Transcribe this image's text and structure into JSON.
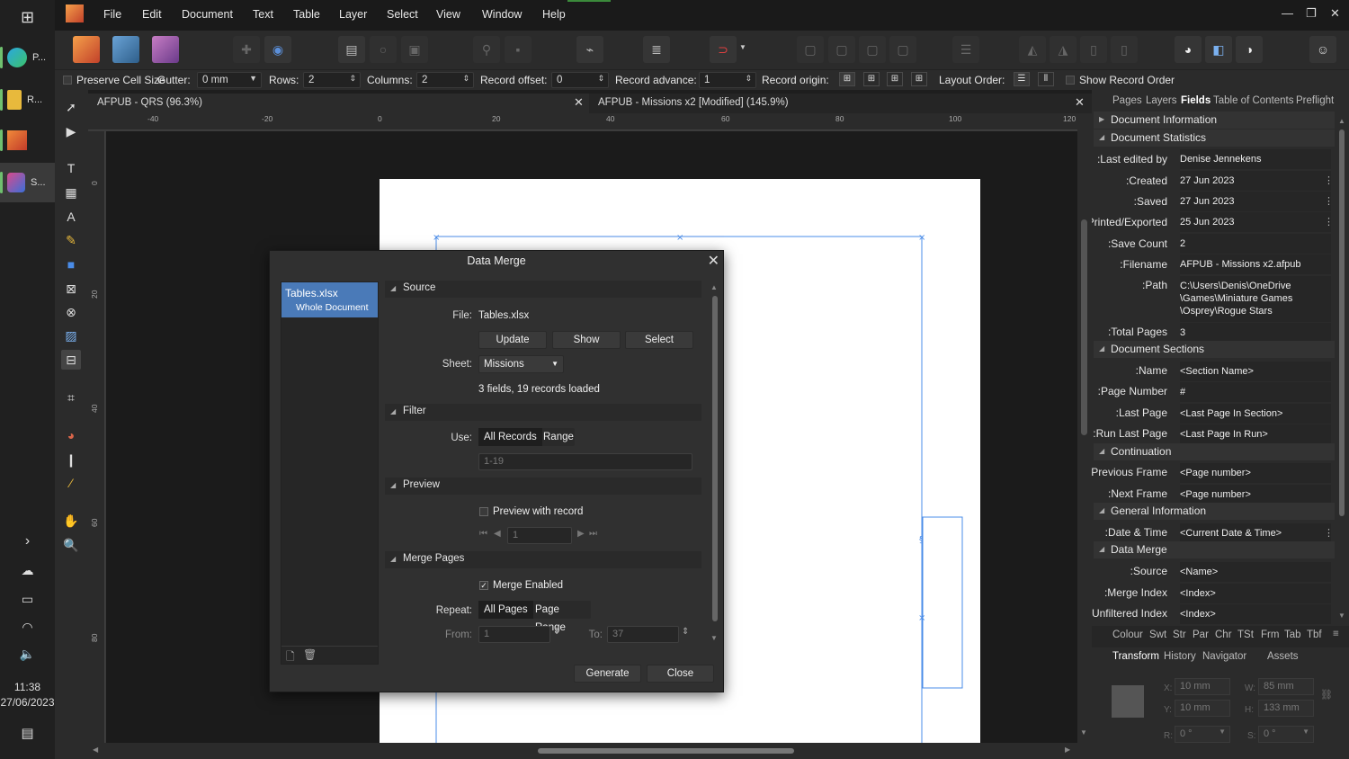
{
  "menubar": {
    "items": [
      "File",
      "Edit",
      "Document",
      "Text",
      "Table",
      "Layer",
      "Select",
      "View",
      "Window",
      "Help"
    ]
  },
  "taskbar": {
    "apps": [
      "P...",
      "R...",
      "",
      "S..."
    ],
    "time": "11:38",
    "date": "27/06/2023"
  },
  "contextbar": {
    "preserve_cell_size": "Preserve Cell Size",
    "gutter_label": "Gutter:",
    "gutter_value": "0 mm",
    "rows_label": "Rows:",
    "rows_value": "2",
    "columns_label": "Columns:",
    "columns_value": "2",
    "record_offset_label": "Record offset:",
    "record_offset_value": "0",
    "record_advance_label": "Record advance:",
    "record_advance_value": "1",
    "record_origin_label": "Record origin:",
    "layout_order_label": "Layout Order:",
    "show_record_order": "Show Record Order"
  },
  "doctabs": [
    {
      "label": "AFPUB - QRS (96.3%)"
    },
    {
      "label": "AFPUB - Missions x2 [Modified] (145.9%)"
    }
  ],
  "ruler": {
    "h": [
      "-40",
      "-20",
      "0",
      "20",
      "40",
      "60",
      "80",
      "100",
      "120"
    ],
    "v": [
      "0",
      "20",
      "40",
      "60",
      "80"
    ]
  },
  "dialog": {
    "title": "Data Merge",
    "list_item_name": "Tables.xlsx",
    "list_item_sub": "Whole Document",
    "source": {
      "heading": "Source",
      "file_label": "File:",
      "file_value": "Tables.xlsx",
      "update": "Update",
      "show": "Show",
      "select": "Select",
      "sheet_label": "Sheet:",
      "sheet_value": "Missions",
      "status": "3 fields, 19 records loaded"
    },
    "filter": {
      "heading": "Filter",
      "use_label": "Use:",
      "all_records": "All Records",
      "range": "Range",
      "range_placeholder": "1-19"
    },
    "preview": {
      "heading": "Preview",
      "preview_with_record": "Preview with record",
      "record_value": "1"
    },
    "merge_pages": {
      "heading": "Merge Pages",
      "merge_enabled": "Merge Enabled",
      "repeat_label": "Repeat:",
      "all_pages": "All Pages",
      "page_range": "Page Range",
      "from_label": "From:",
      "from_value": "1",
      "to_label": "To:",
      "to_value": "37"
    },
    "generate": "Generate",
    "close": "Close"
  },
  "rpanel": {
    "tabs": [
      "Pages",
      "Layers",
      "Fields",
      "Table of Contents",
      "Preflight"
    ],
    "sections": {
      "doc_info": "Document Information",
      "doc_stats": "Document Statistics",
      "doc_sections": "Document Sections",
      "continuation": "Continuation",
      "general_info": "General Information",
      "data_merge": "Data Merge"
    },
    "fields": {
      "last_edited_l": "Last edited by:",
      "last_edited_v": "Denise Jennekens",
      "created_l": "Created:",
      "created_v": "27 Jun 2023",
      "saved_l": "Saved:",
      "saved_v": "27 Jun 2023",
      "printed_l": "Printed/Exported:",
      "printed_v": "25 Jun 2023",
      "save_count_l": "Save Count:",
      "save_count_v": "2",
      "filename_l": "Filename:",
      "filename_v": "AFPUB - Missions x2.afpub",
      "path_l": "Path:",
      "path_v1": "C:\\Users\\Denis\\OneDrive",
      "path_v2": "\\Games\\Miniature Games",
      "path_v3": "\\Osprey\\Rogue Stars",
      "total_pages_l": "Total Pages:",
      "total_pages_v": "3",
      "name_l": "Name:",
      "name_v": "<Section Name>",
      "page_number_l": "Page Number:",
      "page_number_v": "#",
      "last_page_l": "Last Page:",
      "last_page_v": "<Last Page In Section>",
      "run_last_page_l": "Run Last Page:",
      "run_last_page_v": "<Last Page In Run>",
      "prev_frame_l": "Previous Frame:",
      "prev_frame_v": "<Page number>",
      "next_frame_l": "Next Frame:",
      "next_frame_v": "<Page number>",
      "date_time_l": "Date & Time:",
      "date_time_v": "<Current Date & Time>",
      "source_l": "Source:",
      "source_v": "<Name>",
      "merge_index_l": "Merge Index:",
      "merge_index_v": "<Index>",
      "unfiltered_index_l": "Unfiltered Index:",
      "unfiltered_index_v": "<Index>"
    },
    "tabs2": [
      "Colour",
      "Swt",
      "Str",
      "Par",
      "Chr",
      "TSt",
      "Frm",
      "Tab",
      "Tbf"
    ],
    "tabs3": [
      "Transform",
      "History",
      "Navigator",
      "Assets"
    ],
    "transform": {
      "x_label": "X:",
      "x_value": "10 mm",
      "y_label": "Y:",
      "y_value": "10 mm",
      "w_label": "W:",
      "w_value": "85 mm",
      "h_label": "H:",
      "h_value": "133 mm",
      "r_label": "R:",
      "r_value": "0 °",
      "s_label": "S:",
      "s_value": "0 °"
    }
  },
  "colors": {
    "accent": "#4a7ab8",
    "selection_line": "#4a8ce8",
    "background": "#2b2b2b"
  }
}
